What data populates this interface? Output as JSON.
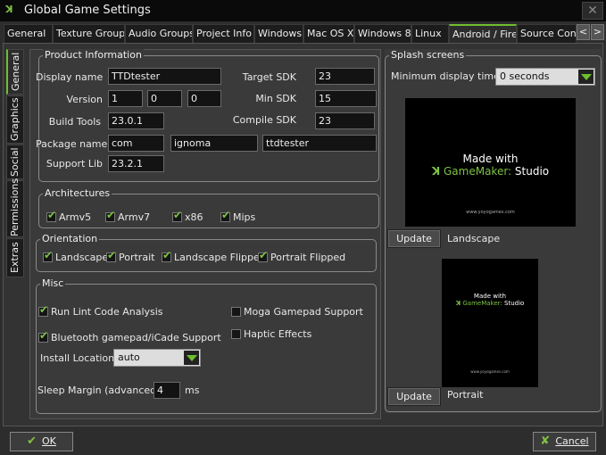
{
  "window": {
    "title": "Global Game Settings",
    "close": "✕"
  },
  "tabs": [
    "General",
    "Texture Groups",
    "Audio Groups",
    "Project Info",
    "Windows",
    "Mac OS X",
    "Windows 8",
    "Linux",
    "Android / Fire",
    "Source Cont"
  ],
  "tab_arrows": [
    "<",
    ">"
  ],
  "side_tabs": [
    "General",
    "Graphics",
    "Social",
    "Permissions",
    "Extras"
  ],
  "product": {
    "legend": "Product Information",
    "display_name_label": "Display name",
    "display_name": "TTDtester",
    "version_label": "Version",
    "version": [
      "1",
      "0",
      "0"
    ],
    "build_tools_label": "Build Tools",
    "build_tools": "23.0.1",
    "package_label": "Package name",
    "package": [
      "com",
      "ignoma",
      "ttdtester"
    ],
    "support_lib_label": "Support Lib",
    "support_lib": "23.2.1",
    "target_sdk_label": "Target SDK",
    "target_sdk": "23",
    "min_sdk_label": "Min SDK",
    "min_sdk": "15",
    "compile_sdk_label": "Compile SDK",
    "compile_sdk": "23"
  },
  "architectures": {
    "legend": "Architectures",
    "items": [
      "Armv5",
      "Armv7",
      "x86",
      "Mips"
    ]
  },
  "orientation": {
    "legend": "Orientation",
    "items": [
      "Landscape",
      "Portrait",
      "Landscape Flipped",
      "Portrait Flipped"
    ]
  },
  "misc": {
    "legend": "Misc",
    "run_lint": "Run Lint Code Analysis",
    "bluetooth": "Bluetooth gamepad/iCade Support",
    "moga": "Moga Gamepad Support",
    "haptic": "Haptic Effects",
    "install_location_label": "Install Location:",
    "install_location": "auto",
    "sleep_margin_label": "Sleep Margin (advanced):",
    "sleep_margin": "4",
    "sleep_unit": "ms"
  },
  "splash": {
    "legend": "Splash screens",
    "min_time_label": "Minimum display time:",
    "min_time": "0 seconds",
    "made_with": "Made with",
    "brand": "GameMaker:",
    "brand2": "Studio",
    "url": "www.yoyogames.com",
    "update": "Update",
    "landscape": "Landscape",
    "portrait": "Portrait"
  },
  "footer": {
    "ok": "OK",
    "cancel": "Cancel"
  },
  "colors": {
    "accent": "#7ec242"
  }
}
